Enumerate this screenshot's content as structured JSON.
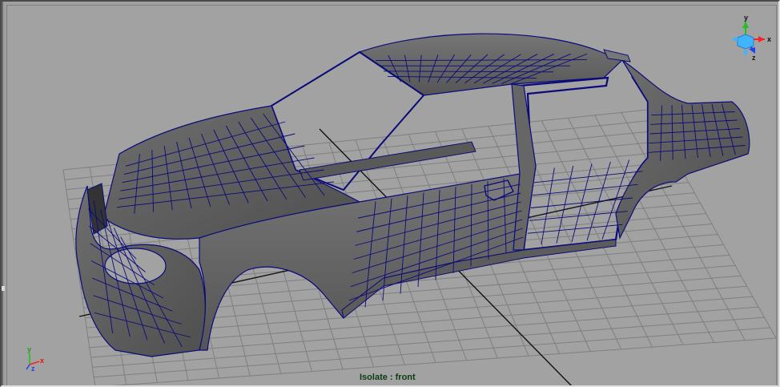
{
  "viewport": {
    "status_text": "Isolate : front",
    "background_color": "#a2a2a2",
    "grid_color": "#7f7f7f",
    "grid_axis_color": "#000000",
    "wireframe_color": "#0a0a7a",
    "surface_color": "#5a5a5a"
  },
  "view_cube": {
    "axis_labels": {
      "x": "x",
      "y": "y",
      "z": "z"
    },
    "colors": {
      "x": "#ff2020",
      "y": "#20c020",
      "z": "#2040ff",
      "cube": "#40b4ff"
    }
  },
  "corner_axis": {
    "axis_labels": {
      "x": "x",
      "y": "y",
      "z": "z"
    },
    "colors": {
      "x": "#ff2020",
      "y": "#20c020",
      "z": "#2040ff"
    }
  },
  "model": {
    "object_name_icon": "car-body-mesh"
  }
}
